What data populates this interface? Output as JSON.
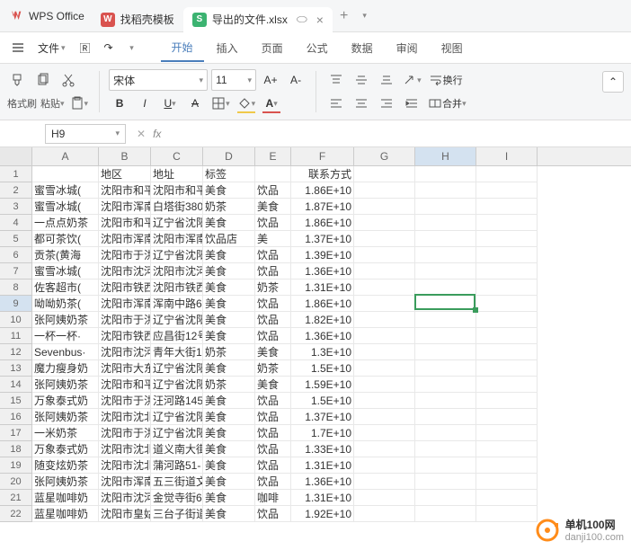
{
  "app": {
    "name": "WPS Office"
  },
  "tabs": [
    {
      "icon_bg": "#d9534f",
      "icon_text": "W",
      "label": "找稻壳模板",
      "active": false,
      "closable": false
    },
    {
      "icon_bg": "#3cb371",
      "icon_text": "S",
      "label": "导出的文件.xlsx",
      "active": true,
      "closable": true
    }
  ],
  "menubar": {
    "file": "文件",
    "items": [
      "开始",
      "插入",
      "页面",
      "公式",
      "数据",
      "审阅",
      "视图"
    ],
    "active": 0
  },
  "toolbar": {
    "format_brush": "格式刷",
    "paste": "粘贴",
    "font_name": "宋体",
    "font_size": "11",
    "wrap": "换行",
    "merge": "合并"
  },
  "refbar": {
    "cell": "H9"
  },
  "columns": [
    "A",
    "B",
    "C",
    "D",
    "E",
    "F",
    "G",
    "H",
    "I"
  ],
  "selection": {
    "row": 9,
    "col": "H"
  },
  "rows": [
    {
      "n": 1,
      "A": "",
      "B": "地区",
      "C": "地址",
      "D": "标签",
      "E": "",
      "F": "联系方式"
    },
    {
      "n": 2,
      "A": "蜜雪冰城(",
      "B": "沈阳市和平",
      "C": "沈阳市和平",
      "D": "美食",
      "E": "饮品",
      "F": "1.86E+10"
    },
    {
      "n": 3,
      "A": "蜜雪冰城(",
      "B": "沈阳市浑南",
      "C": "白塔街380",
      "D": "奶茶",
      "E": "美食",
      "F": "1.87E+10"
    },
    {
      "n": 4,
      "A": "一点点奶茶",
      "B": "沈阳市和平",
      "C": "辽宁省沈阳",
      "D": "美食",
      "E": "饮品",
      "F": "1.86E+10"
    },
    {
      "n": 5,
      "A": "都可茶饮(",
      "B": "沈阳市浑南",
      "C": "沈阳市浑南",
      "D": "饮品店",
      "E": "美",
      "F": "1.37E+10"
    },
    {
      "n": 6,
      "A": "贡茶(黄海",
      "B": "沈阳市于洪",
      "C": "辽宁省沈阳",
      "D": "美食",
      "E": "饮品",
      "F": "1.39E+10"
    },
    {
      "n": 7,
      "A": "蜜雪冰城(",
      "B": "沈阳市沈河",
      "C": "沈阳市沈河",
      "D": "美食",
      "E": "饮品",
      "F": "1.36E+10"
    },
    {
      "n": 8,
      "A": "佐客超市(",
      "B": "沈阳市铁西",
      "C": "沈阳市铁西",
      "D": "美食",
      "E": "奶茶",
      "F": "1.31E+10"
    },
    {
      "n": 9,
      "A": "呦呦奶茶(",
      "B": "沈阳市浑南",
      "C": "浑南中路6",
      "D": "美食",
      "E": "饮品",
      "F": "1.86E+10"
    },
    {
      "n": 10,
      "A": "张阿姨奶茶",
      "B": "沈阳市于洪",
      "C": "辽宁省沈阳",
      "D": "美食",
      "E": "饮品",
      "F": "1.82E+10"
    },
    {
      "n": 11,
      "A": "一杯一杯·",
      "B": "沈阳市铁西",
      "C": "应昌街12号",
      "D": "美食",
      "E": "饮品",
      "F": "1.36E+10"
    },
    {
      "n": 12,
      "A": "Sevenbus·",
      "B": "沈阳市沈河",
      "C": "青年大街1",
      "D": "奶茶",
      "E": "美食",
      "F": "1.3E+10"
    },
    {
      "n": 13,
      "A": "魔力瘦身奶",
      "B": "沈阳市大东",
      "C": "辽宁省沈阳",
      "D": "美食",
      "E": "奶茶",
      "F": "1.5E+10"
    },
    {
      "n": 14,
      "A": "张阿姨奶茶",
      "B": "沈阳市和平",
      "C": "辽宁省沈阳",
      "D": "奶茶",
      "E": "美食",
      "F": "1.59E+10"
    },
    {
      "n": 15,
      "A": "万象泰式奶",
      "B": "沈阳市于洪",
      "C": "汪河路145",
      "D": "美食",
      "E": "饮品",
      "F": "1.5E+10"
    },
    {
      "n": 16,
      "A": "张阿姨奶茶",
      "B": "沈阳市沈北",
      "C": "辽宁省沈阳",
      "D": "美食",
      "E": "饮品",
      "F": "1.37E+10"
    },
    {
      "n": 17,
      "A": "一米奶茶",
      "B": "沈阳市于洪",
      "C": "辽宁省沈阳",
      "D": "美食",
      "E": "饮品",
      "F": "1.7E+10"
    },
    {
      "n": 18,
      "A": "万象泰式奶",
      "B": "沈阳市沈北",
      "C": "道义南大街",
      "D": "美食",
      "E": "饮品",
      "F": "1.33E+10"
    },
    {
      "n": 19,
      "A": "随变炫奶茶",
      "B": "沈阳市沈北",
      "C": "蒲河路51-",
      "D": "美食",
      "E": "饮品",
      "F": "1.31E+10"
    },
    {
      "n": 20,
      "A": "张阿姨奶茶",
      "B": "沈阳市浑南",
      "C": "五三街道文",
      "D": "美食",
      "E": "饮品",
      "F": "1.36E+10"
    },
    {
      "n": 21,
      "A": "蓝星咖啡奶",
      "B": "沈阳市沈河",
      "C": "金觉寺街6",
      "D": "美食",
      "E": "咖啡",
      "F": "1.31E+10"
    },
    {
      "n": 22,
      "A": "蓝星咖啡奶",
      "B": "沈阳市皇姑",
      "C": "三台子街道",
      "D": "美食",
      "E": "饮品",
      "F": "1.92E+10"
    }
  ],
  "watermark": {
    "main": "单机100网",
    "sub": "danji100.com"
  }
}
